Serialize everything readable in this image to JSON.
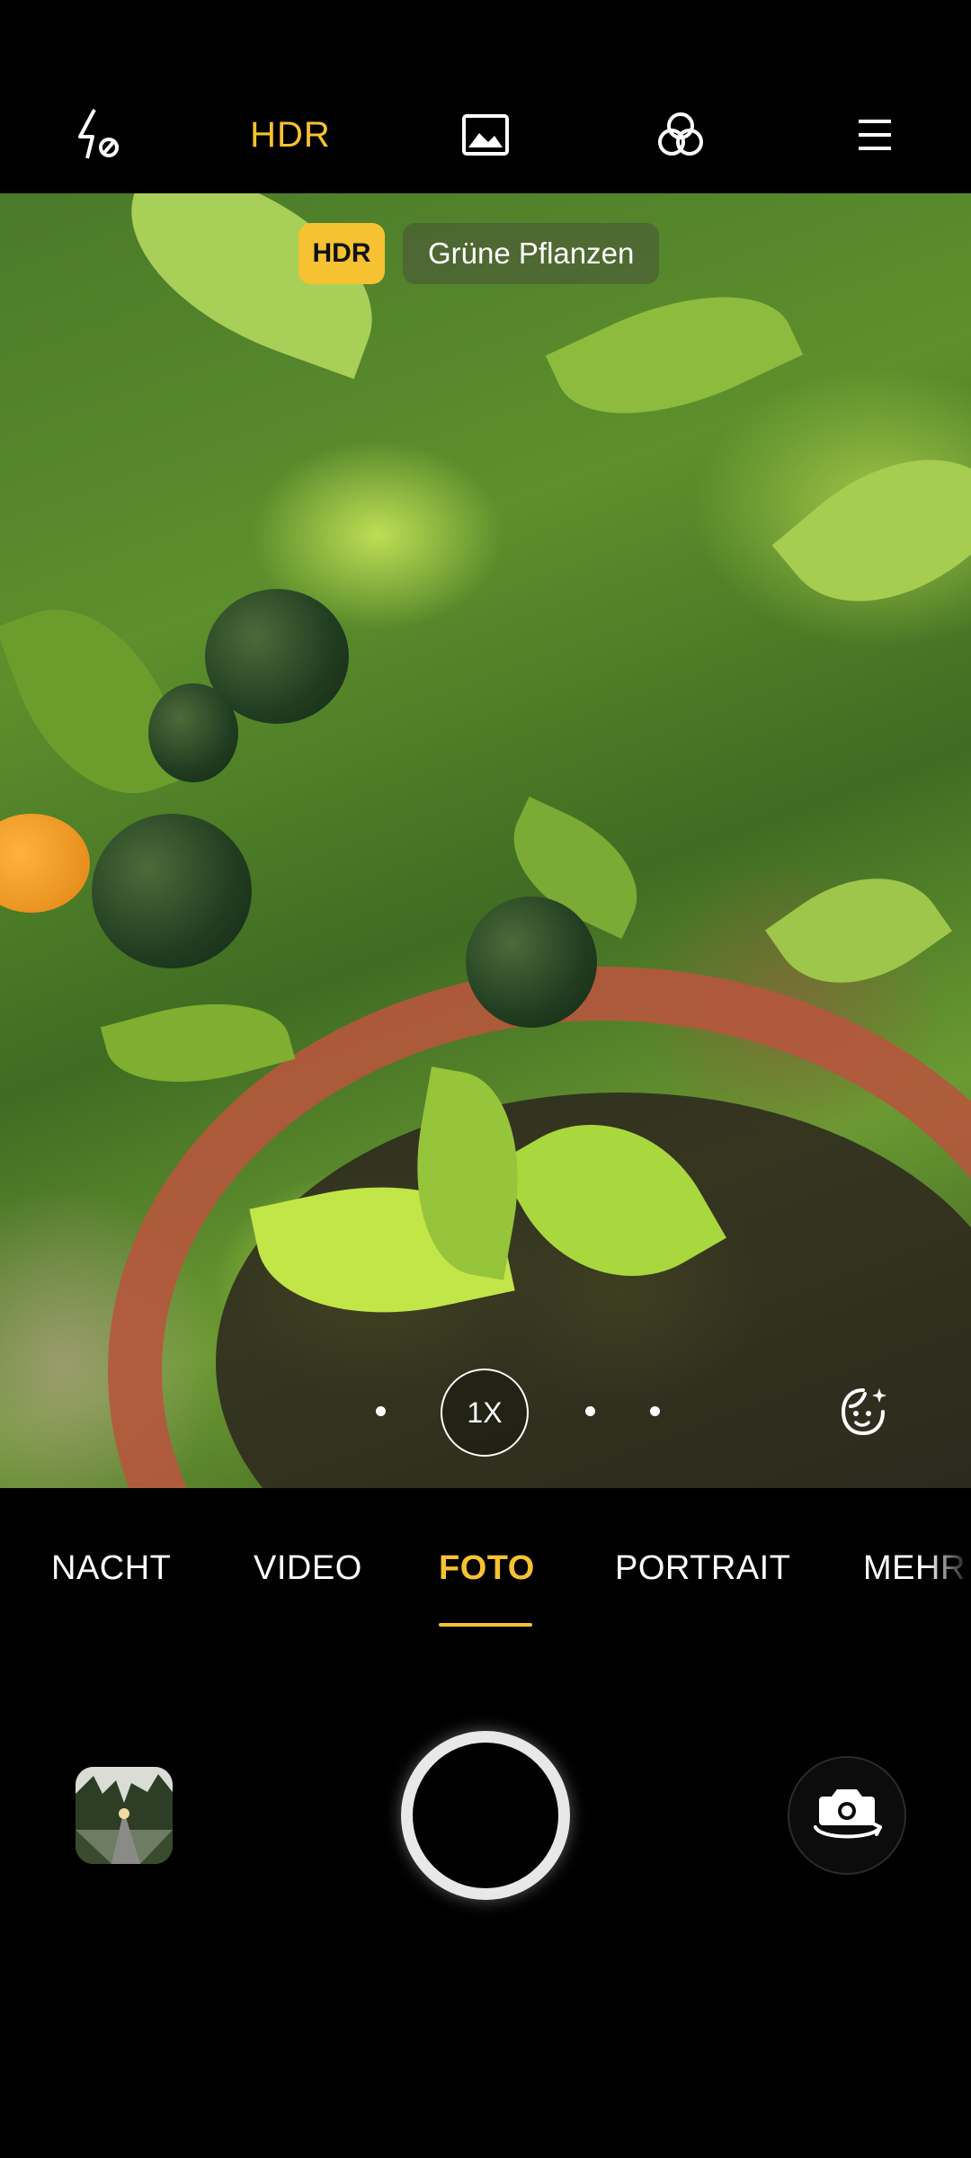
{
  "toolbar": {
    "hdr_label": "HDR",
    "icons": [
      "flash-auto-icon",
      "gallery-image-icon",
      "filter-icon",
      "menu-icon"
    ]
  },
  "viewfinder": {
    "hdr_badge": "HDR",
    "scene_label": "Grüne Pflanzen",
    "zoom_label": "1X"
  },
  "modes": [
    {
      "label": "NACHT",
      "active": false
    },
    {
      "label": "VIDEO",
      "active": false
    },
    {
      "label": "FOTO",
      "active": true
    },
    {
      "label": "PORTRAIT",
      "active": false
    },
    {
      "label": "MEHR",
      "active": false
    }
  ],
  "colors": {
    "accent": "#f6c231",
    "background": "#000000"
  }
}
